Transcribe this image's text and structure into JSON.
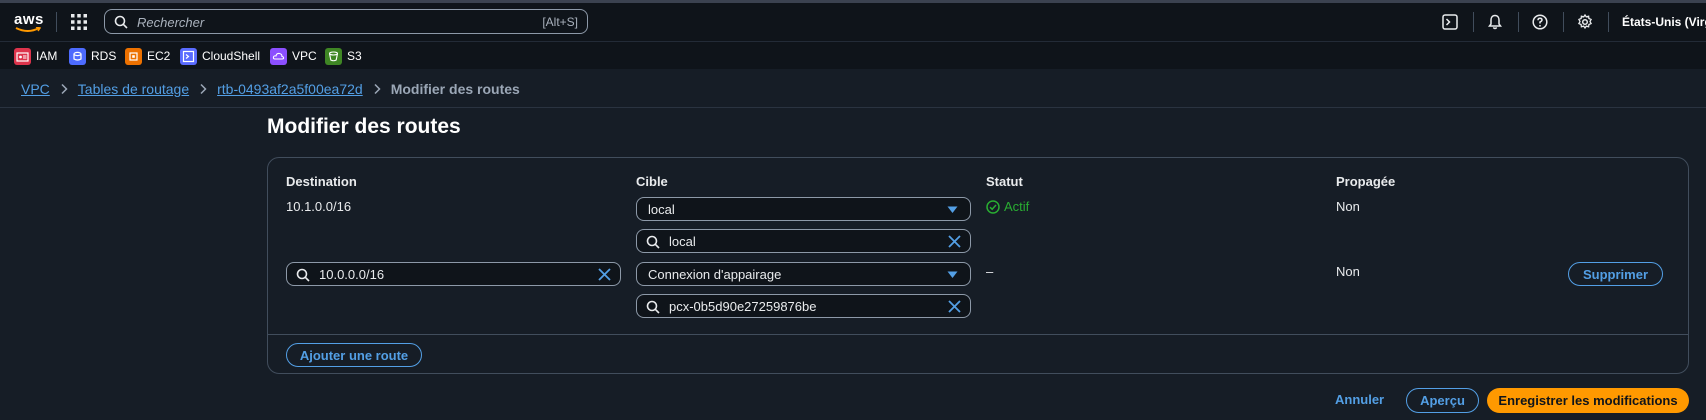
{
  "topnav": {
    "search_placeholder": "Rechercher",
    "search_shortcut": "[Alt+S]",
    "region": "États-Unis (Virgi"
  },
  "favorites": [
    {
      "label": "IAM",
      "color": "#dd344c"
    },
    {
      "label": "RDS",
      "color": "#4d6bfe"
    },
    {
      "label": "EC2",
      "color": "#ed7100"
    },
    {
      "label": "CloudShell",
      "color": "#5a6bff"
    },
    {
      "label": "VPC",
      "color": "#8c4fff"
    },
    {
      "label": "S3",
      "color": "#3f8624"
    }
  ],
  "breadcrumb": {
    "items": [
      "VPC",
      "Tables de routage",
      "rtb-0493af2a5f00ea72d"
    ],
    "current": "Modifier des routes"
  },
  "page": {
    "title": "Modifier des routes"
  },
  "table": {
    "headers": {
      "destination": "Destination",
      "target": "Cible",
      "status": "Statut",
      "propagated": "Propagée"
    },
    "rows": [
      {
        "destination": "10.1.0.0/16",
        "target_select": "local",
        "target_filter": "local",
        "status": "Actif",
        "propagated": "Non"
      },
      {
        "destination": "10.0.0.0/16",
        "target_select": "Connexion d'appairage",
        "target_filter": "pcx-0b5d90e27259876be",
        "status": "–",
        "propagated": "Non",
        "remove_label": "Supprimer"
      }
    ],
    "add_route_label": "Ajouter une route"
  },
  "footer": {
    "cancel_label": "Annuler",
    "preview_label": "Aperçu",
    "save_label": "Enregistrer les modifications"
  },
  "colors": {
    "accent": "#539fe5",
    "primary": "#ff9900",
    "success": "#29ad32",
    "background": "#161d26"
  }
}
